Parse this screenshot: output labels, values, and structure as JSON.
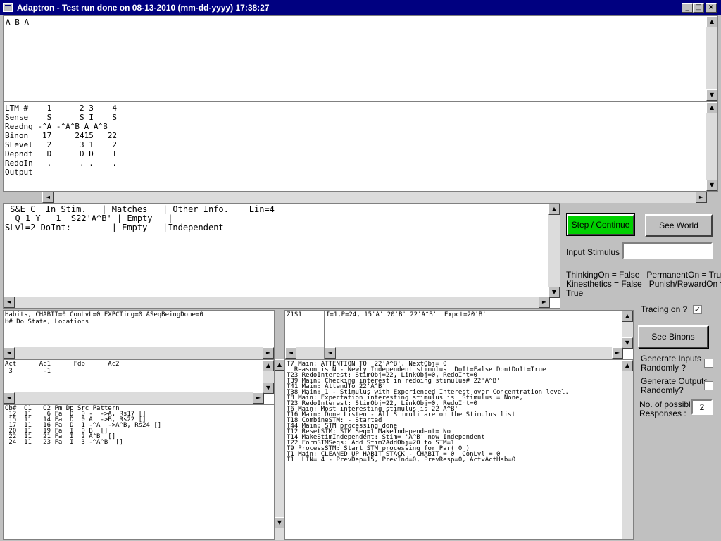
{
  "window": {
    "title": "Adaptron - Test run done on 08-13-2010 (mm-dd-yyyy) 17:38:27",
    "minimize_glyph": "_",
    "maximize_glyph": "□",
    "close_glyph": "×"
  },
  "top_pane": {
    "text": "A B A"
  },
  "ltm_table": {
    "text": "LTM #    1      2 3    4\nSense    S      S I    S\nReadng -^A -^A^B A A^B\nBinon   17     2415   22\nSLevel   2      3 1    2\nDepndt   D      D D    I\nRedoIn   .      . .    .\nOutput"
  },
  "stim_pane": {
    "text": " S&E C  In Stim.   | Matches   | Other Info.    Lin=4\n  Q 1 Y   1  S22'A^B' | Empty   |\nSLvl=2 DoInt:        | Empty   |Independent"
  },
  "habits_pane": {
    "text": "Habits, CHABIT=0 ConLvL=0 EXPCTing=0 ASeqBeingDone=0\nH# Do State, Locations"
  },
  "z1s1_pane": {
    "label": "Z1S1"
  },
  "expect_pane": {
    "text": "I=1,P=24, 15'A' 20'B' 22'A^B'  Expct=20'B'"
  },
  "act_pane": {
    "text": "Act      Ac1      Fdb      Ac2\n 3        -1"
  },
  "ob_pane": {
    "text": "Ob#  O1   O2 Pm Dp Src Pattern\n 12  11    6 Fa  D  0 -  ->A, Rs17 []\n 15  11   14 Fa  D  0 A  ->B, Rs22 []\n 17  11   16 Fa  D  1 -^A  ->A^B, Rs24 []\n 20  11   19 Fa  I  0 B  []\n 22  11   21 Fa  I  2 A^B  []\n 24  11   23 Fa  I  3 -^A^B  []"
  },
  "trace_pane": {
    "text": "T7 Main: ATTENTION TO  22'A^B', NextObj= 0\n  Reason is N - Newly Independent stimulus  DoIt=False DontDoIt=True\nT23 RedoInterest: StimObj=22, LinkObj=0, RedoInt=0\nT39 Main: Checking interest in redoing stimulus# 22'A^B'\nT41 Main: AttendTo 22'A^B'\nT38 Main: 1 - Stimulus with Experienced Interest over Concentration level.\nT8 Main: Expectation interesting stimulus is  Stimulus = None,\nT23 RedoInterest: StimObj=22, LinkObj=0, RedoInt=0\nT6 Main: Most interesting stimulus is 22'A^B'\nT16 Main: Done Listen - All Stimuli are on the Stimulus list\nT18 CombineSTM: - Started\nT44 Main: STM processing done\nT12 ResetSTM: STM Seq=1 MakeIndependent= No\nT14 MakeStimIndependent: Stim= 'A^B' now Independent\nT22 FormSTMSeqs: Add Stim2AddObj=20 to STM=1\nT9 ProcessSTM: Start STM processing for Par( 0 )\nT1 Main: CLEANED UP HABIT STACK - CHABIT = 0  ConLvl = 0\nT1  LIN= 4 - PrevDep=15, PrevInd=0, PrevResp=0, ActvActHab=0"
  },
  "controls": {
    "step_button": "Step / Continue",
    "see_world_button": "See World",
    "input_stimulus_label": "Input Stimulus :",
    "input_stimulus_value": "",
    "thinking_on": "ThinkingOn = False",
    "permanent_on": "PermanentOn = True",
    "kinesthetics": "Kinesthetics = False",
    "punish_reward": "Punish/RewardOn =",
    "punish_reward_value": "True",
    "tracing_label": "Tracing on ?",
    "tracing_checked": "✓",
    "see_binons_button": "See Binons",
    "gen_inputs_label_1": "Generate Inputs",
    "gen_inputs_label_2": "Randomly ?",
    "gen_outputs_label_1": "Generate Outputs",
    "gen_outputs_label_2": "Randomly?",
    "responses_label_1": "No. of possible",
    "responses_label_2": "Responses :",
    "responses_value": "2"
  },
  "icons": {
    "scroll_up": "▲",
    "scroll_down": "▼",
    "scroll_left": "◄",
    "scroll_right": "►"
  },
  "colors": {
    "title_bar": "#000080",
    "step_button": "#00d000",
    "face": "#c0c0c0"
  }
}
